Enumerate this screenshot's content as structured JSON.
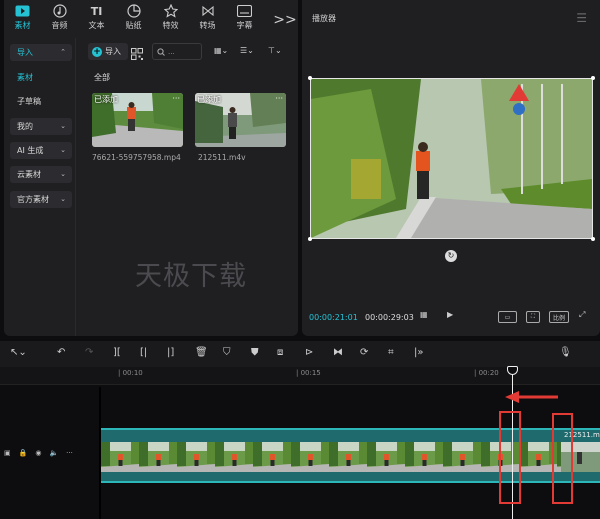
{
  "tabs": [
    {
      "label": "素材",
      "icon": "media-icon",
      "active": true
    },
    {
      "label": "音频",
      "icon": "audio-icon",
      "active": false
    },
    {
      "label": "文本",
      "icon": "text-icon",
      "active": false
    },
    {
      "label": "贴纸",
      "icon": "sticker-icon",
      "active": false
    },
    {
      "label": "特效",
      "icon": "effects-icon",
      "active": false
    },
    {
      "label": "转场",
      "icon": "transition-icon",
      "active": false
    },
    {
      "label": "字幕",
      "icon": "caption-icon",
      "active": false
    }
  ],
  "tabs_more": ">>",
  "sidebar": {
    "import": "导入",
    "media": "素材",
    "draft": "子草稿",
    "mine": "我的",
    "ai": "AI 生成",
    "cloud": "云素材",
    "official": "官方素材"
  },
  "toolbar": {
    "import_label": "导入",
    "search_placeholder": "...",
    "all_label": "全部"
  },
  "media": [
    {
      "tag": "已添加",
      "name": "76621-559757958.mp4"
    },
    {
      "tag": "已添加",
      "name": "212511.m4v"
    }
  ],
  "watermark": "天极下载",
  "player": {
    "title": "播放器",
    "time_current": "00:00:21:01",
    "time_total": "00:00:29:03",
    "ratio_label": "比例"
  },
  "timeline": {
    "ruler": [
      "| 00:10",
      "| 00:15",
      "| 00:20"
    ],
    "clip2_label": "212511.m"
  },
  "colors": {
    "accent": "#25c2d4",
    "clip": "#1e6a6d",
    "highlight": "#e23a34"
  }
}
